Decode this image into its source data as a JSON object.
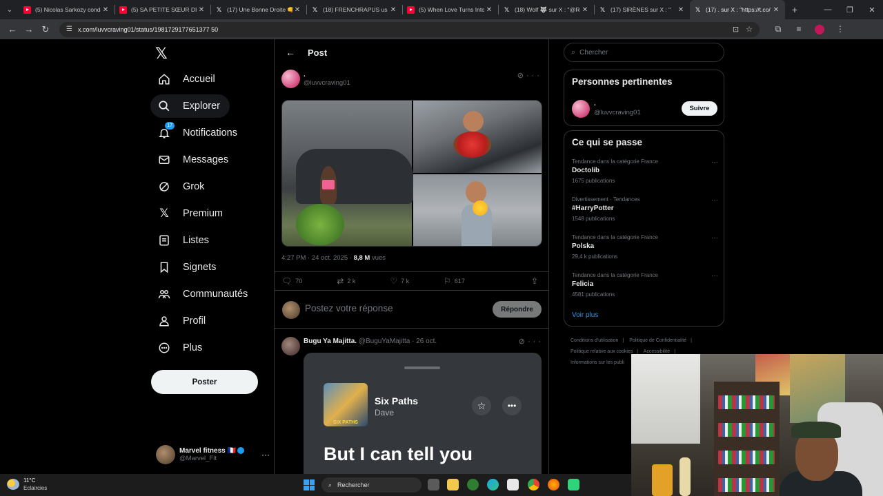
{
  "browser": {
    "tabs": [
      {
        "title": "(5) Nicolas Sarkozy conda",
        "favicon": "youtube-icon",
        "active": false
      },
      {
        "title": "(5) SA PETITE SŒUR DISPA",
        "favicon": "youtube-icon",
        "active": false
      },
      {
        "title": "(17) Une Bonne Droite 👊",
        "favicon": "x-icon",
        "active": false
      },
      {
        "title": "(18) FRENCHRAPUS us su",
        "favicon": "x-icon",
        "active": false
      },
      {
        "title": "(5) When Love Turns Into",
        "favicon": "youtube-icon",
        "active": false
      },
      {
        "title": "(18) Wolf 🐺 sur X : \"@Ro",
        "favicon": "x-icon",
        "active": false
      },
      {
        "title": "(17) SIRÈNES sur X : \"",
        "favicon": "x-icon",
        "active": false
      },
      {
        "title": "(17) . sur X : \"https://t.co/",
        "favicon": "x-icon",
        "active": true
      }
    ],
    "url": "x.com/luvvcraving01/status/1981729177651377 50"
  },
  "sidebar": {
    "items": [
      {
        "label": "Accueil",
        "icon": "home-icon"
      },
      {
        "label": "Explorer",
        "icon": "search-icon",
        "selected": true
      },
      {
        "label": "Notifications",
        "icon": "bell-icon",
        "badge": "17"
      },
      {
        "label": "Messages",
        "icon": "mail-icon"
      },
      {
        "label": "Grok",
        "icon": "grok-icon"
      },
      {
        "label": "Premium",
        "icon": "x-logo-icon"
      },
      {
        "label": "Listes",
        "icon": "list-icon"
      },
      {
        "label": "Signets",
        "icon": "bookmark-icon"
      },
      {
        "label": "Communautés",
        "icon": "communities-icon"
      },
      {
        "label": "Profil",
        "icon": "profile-icon"
      },
      {
        "label": "Plus",
        "icon": "more-circle-icon"
      }
    ],
    "post_button": "Poster",
    "account": {
      "name": "Marvel fitness 🇫🇷",
      "handle": "@Marvel_Flt"
    }
  },
  "main": {
    "header_title": "Post",
    "tweet": {
      "name": ".",
      "handle": "@luvvcraving01",
      "time": "4:27 PM · 24 oct. 2025 · ",
      "views_count": "8,8 M",
      "views_label": " vues",
      "stats": {
        "replies": "70",
        "reposts": "2 k",
        "likes": "7 k",
        "bookmarks": "617"
      }
    },
    "reply_placeholder": "Postez votre réponse",
    "reply_button": "Répondre",
    "reply": {
      "name": "Bugu Ya Majitta.",
      "handle_date": "@BuguYaMajitta · 26 oct.",
      "card": {
        "album_text": "SIX PATHS",
        "song": "Six Paths",
        "artist": "Dave",
        "lyric": "But I can tell you"
      }
    }
  },
  "right": {
    "search_placeholder": "Chercher",
    "relevant_title": "Personnes pertinentes",
    "relevant_person": {
      "name": ".",
      "handle": "@luvvcraving01",
      "follow_label": "Suivre"
    },
    "trends_title": "Ce qui se passe",
    "trends": [
      {
        "context": "Tendance dans la catégorie France",
        "name": "Doctolib",
        "posts": "1675 publications"
      },
      {
        "context": "Divertissement · Tendances",
        "name": "#HarryPotter",
        "posts": "1548 publications"
      },
      {
        "context": "Tendance dans la catégorie France",
        "name": "Polska",
        "posts": "29,4 k publications"
      },
      {
        "context": "Tendance dans la catégorie France",
        "name": "Felicia",
        "posts": "4581 publications"
      }
    ],
    "see_more": "Voir plus",
    "footer": [
      "Conditions d'utilisation",
      "Politique de Confidentialité",
      "Politique relative aux cookies",
      "Accessibilité",
      "Informations sur les publi"
    ]
  },
  "taskbar": {
    "temperature": "11°C",
    "weather": "Eclaircies",
    "search": "Rechercher"
  },
  "colors": {
    "accent": "#1d9bf0",
    "background": "#000000",
    "border": "#2f3336",
    "muted": "#71767b"
  }
}
